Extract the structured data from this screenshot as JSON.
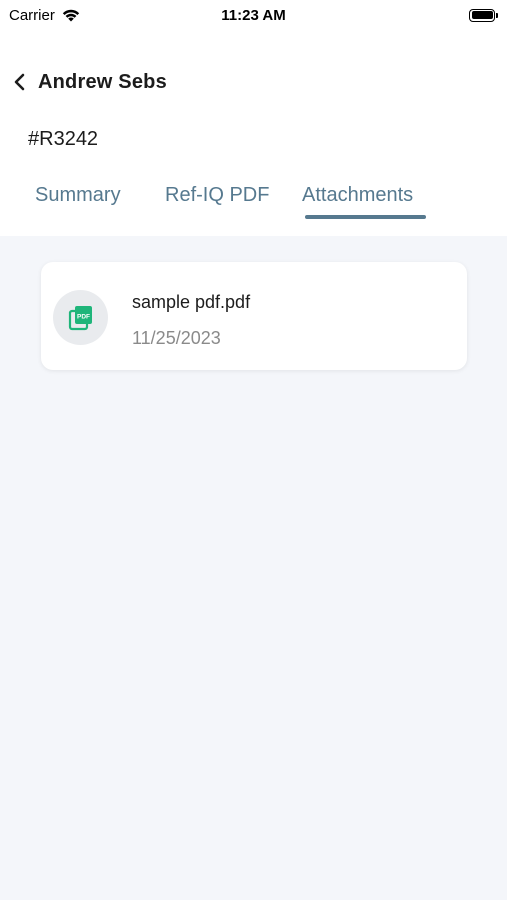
{
  "status_bar": {
    "carrier": "Carrier",
    "time": "11:23 AM"
  },
  "header": {
    "title": "Andrew Sebs",
    "reference_id": "#R3242"
  },
  "tabs": [
    {
      "label": "Summary",
      "active": false
    },
    {
      "label": "Ref-IQ PDF",
      "active": false
    },
    {
      "label": "Attachments",
      "active": true
    }
  ],
  "attachments": [
    {
      "name": "sample pdf.pdf",
      "date": "11/25/2023",
      "icon": "pdf-file-icon"
    }
  ],
  "colors": {
    "accent": "#56798f",
    "pdf_icon": "#1fb57a",
    "content_bg": "#f4f6fa"
  }
}
